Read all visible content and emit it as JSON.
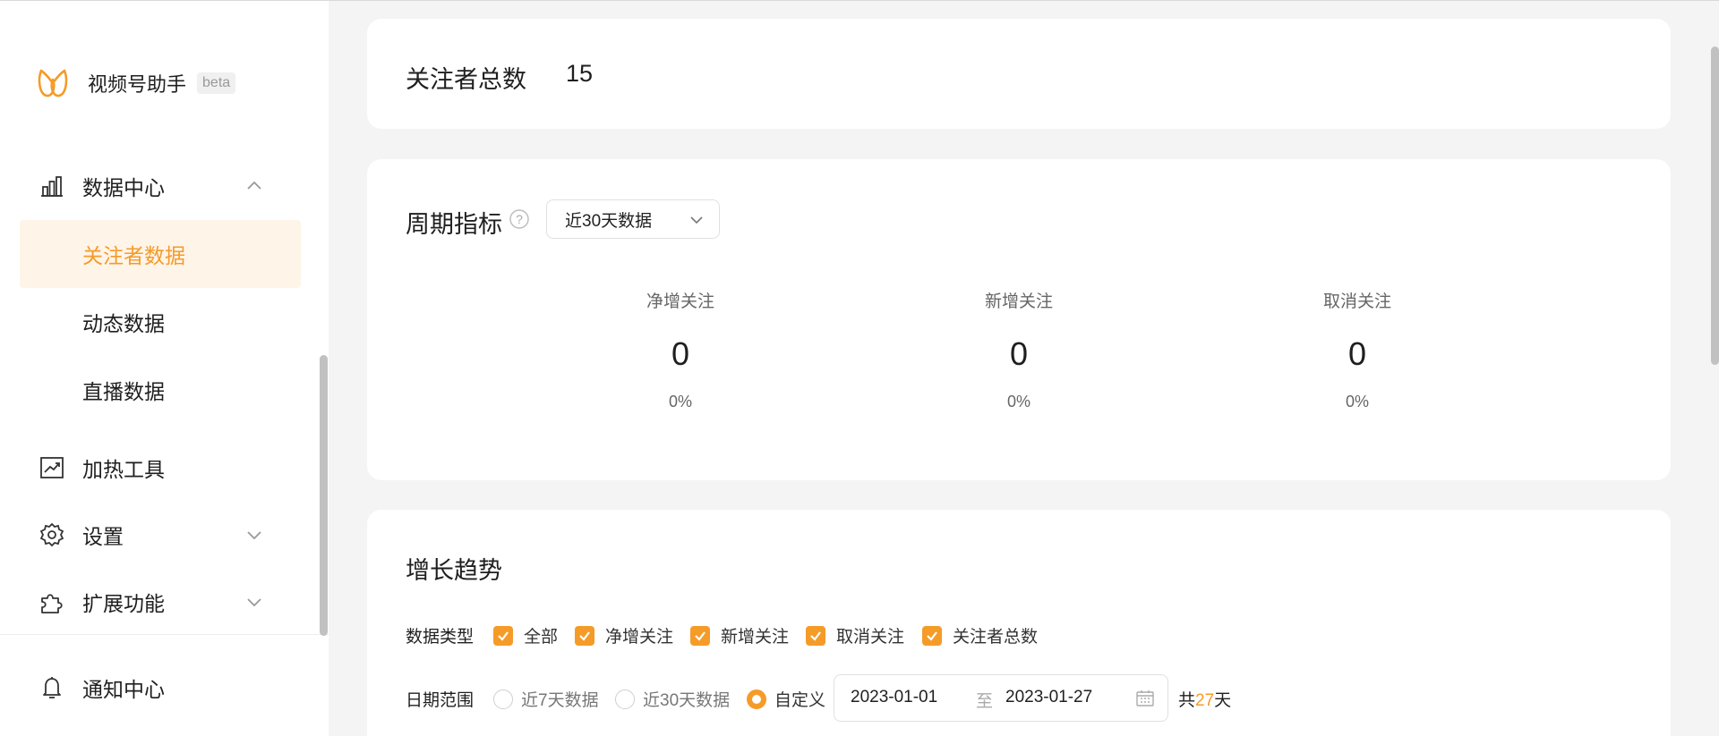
{
  "brand": {
    "name": "视频号助手",
    "badge": "beta",
    "accent_color": "#f59b28"
  },
  "sidebar": {
    "data_center": {
      "label": "数据中心",
      "icon": "bar-chart-icon",
      "expanded": true,
      "children": [
        {
          "label": "关注者数据",
          "active": true
        },
        {
          "label": "动态数据",
          "active": false
        },
        {
          "label": "直播数据",
          "active": false
        }
      ]
    },
    "items": [
      {
        "label": "加热工具",
        "icon": "trend-chart-icon"
      },
      {
        "label": "设置",
        "icon": "gear-icon"
      },
      {
        "label": "扩展功能",
        "icon": "puzzle-icon"
      },
      {
        "label": "通知中心",
        "icon": "bell-icon"
      }
    ]
  },
  "followers_total": {
    "label": "关注者总数",
    "value": "15"
  },
  "period_metrics": {
    "title": "周期指标",
    "select_value": "近30天数据",
    "metrics": [
      {
        "label": "净增关注",
        "value": "0",
        "pct": "0%"
      },
      {
        "label": "新增关注",
        "value": "0",
        "pct": "0%"
      },
      {
        "label": "取消关注",
        "value": "0",
        "pct": "0%"
      }
    ]
  },
  "growth_trend": {
    "title": "增长趋势",
    "data_type_label": "数据类型",
    "data_types": [
      "全部",
      "净增关注",
      "新增关注",
      "取消关注",
      "关注者总数"
    ],
    "date_range_label": "日期范围",
    "date_options": [
      {
        "label": "近7天数据",
        "selected": false
      },
      {
        "label": "近30天数据",
        "selected": false
      },
      {
        "label": "自定义",
        "selected": true
      }
    ],
    "start_date": "2023-01-01",
    "separator": "至",
    "end_date": "2023-01-27",
    "total_prefix": "共",
    "total_days": "27",
    "total_suffix": "天"
  }
}
